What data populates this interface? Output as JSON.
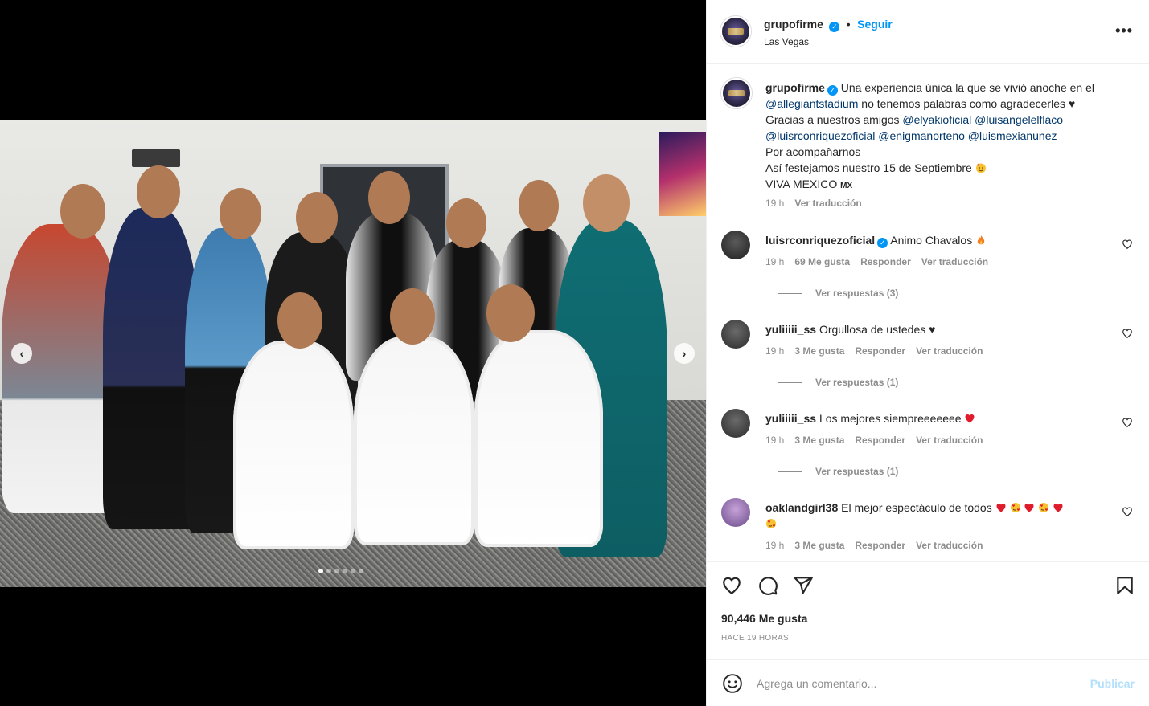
{
  "post": {
    "author": "grupofirme",
    "follow_label": "Seguir",
    "separator": "•",
    "location": "Las Vegas",
    "more_label": "•••",
    "carousel_count": 6,
    "carousel_active_index": 0
  },
  "caption": {
    "username": "grupofirme",
    "line1": "Una experiencia única la que se vivió anoche en el",
    "mention_stadium": "@allegiantstadium",
    "line2_rest": "no tenemos palabras como agradecerles ♥",
    "line3_prefix": "Gracias a nuestros amigos",
    "mention_1": "@elyakioficial",
    "mention_2": "@luisangelelflaco",
    "mention_3": "@luisrconriquezoficial",
    "mention_4": "@enigmanorteno",
    "mention_5": "@luismexianunez",
    "line5": "Por acompañarnos",
    "line6": "Así festejamos nuestro 15 de Septiembre",
    "line7": "VIVA MEXICO",
    "line7_flag": "MX",
    "time": "19 h",
    "translate": "Ver traducción"
  },
  "comments": [
    {
      "username": "luisrconriquezoficial",
      "verified": true,
      "text": "Animo Chavalos",
      "time": "19 h",
      "likes": "69 Me gusta",
      "reply": "Responder",
      "translate": "Ver traducción",
      "replies": "Ver respuestas (3)"
    },
    {
      "username": "yuliiiii_ss",
      "verified": false,
      "text": "Orgullosa de ustedes ♥",
      "time": "19 h",
      "likes": "3 Me gusta",
      "reply": "Responder",
      "translate": "Ver traducción",
      "replies": "Ver respuestas (1)"
    },
    {
      "username": "yuliiiii_ss",
      "verified": false,
      "text": "Los mejores siempreeeeeee",
      "time": "19 h",
      "likes": "3 Me gusta",
      "reply": "Responder",
      "translate": "Ver traducción",
      "replies": "Ver respuestas (1)"
    },
    {
      "username": "oaklandgirl38",
      "verified": false,
      "text": "El mejor espectáculo de todos",
      "time": "19 h",
      "likes": "3 Me gusta",
      "reply": "Responder",
      "translate": "Ver traducción"
    }
  ],
  "actions": {
    "likes": "90,446 Me gusta",
    "date": "HACE 19 HORAS"
  },
  "add_comment": {
    "placeholder": "Agrega un comentario...",
    "publish": "Publicar"
  },
  "colors": {
    "link_blue": "#0095f6",
    "mention": "#00376b",
    "secondary_text": "#8e8e8e",
    "heart_red": "#ed4956"
  },
  "icons": [
    "like-icon",
    "comment-icon",
    "share-icon",
    "save-icon",
    "emoji-icon",
    "verified-icon",
    "more-icon",
    "arrow-left-icon",
    "arrow-right-icon"
  ]
}
